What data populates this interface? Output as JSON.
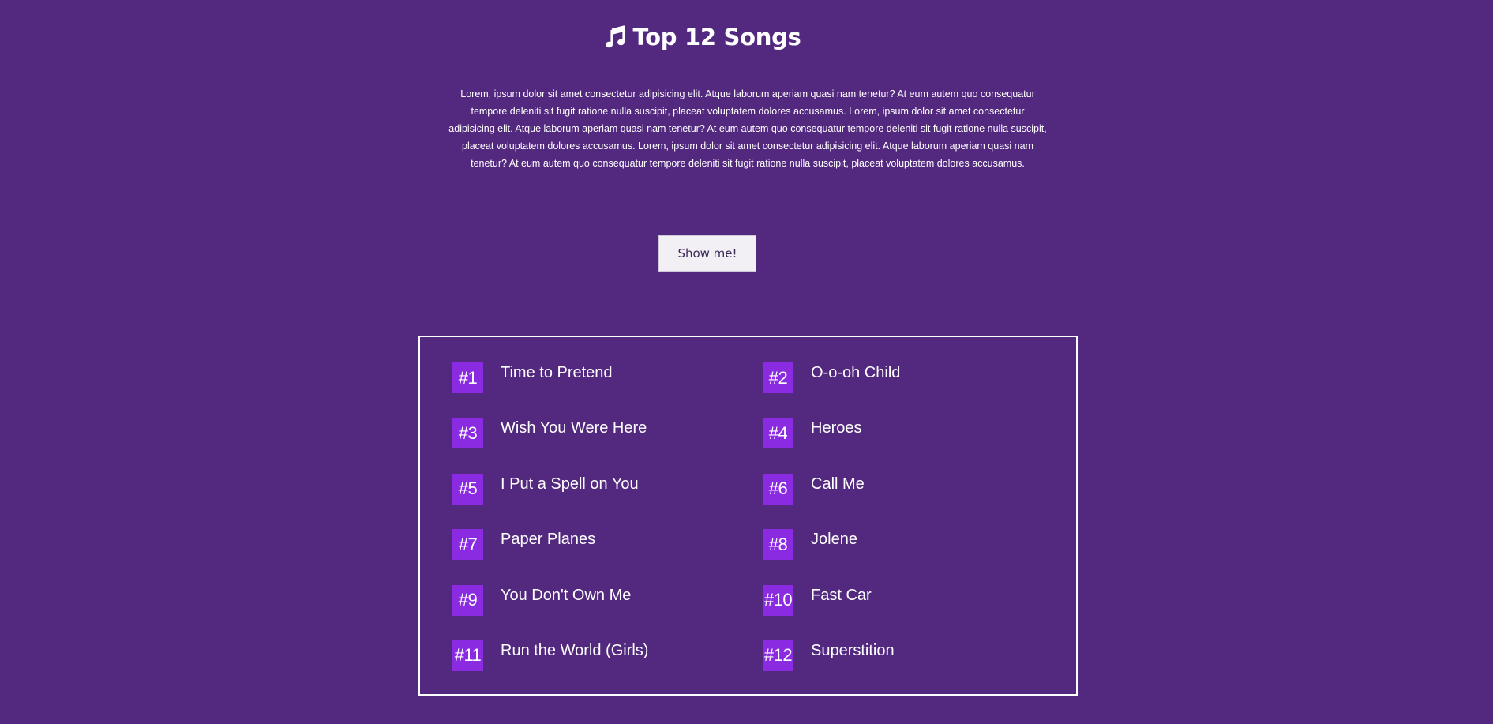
{
  "header": {
    "icon": "music-note-icon",
    "title": "Top 12 Songs"
  },
  "intro": {
    "text": "Lorem, ipsum dolor sit amet consectetur adipisicing elit. Atque laborum aperiam quasi nam tenetur? At eum autem quo consequatur tempore deleniti sit fugit ratione nulla suscipit, placeat voluptatem dolores accusamus. Lorem, ipsum dolor sit amet consectetur adipisicing elit. Atque laborum aperiam quasi nam tenetur? At eum autem quo consequatur tempore deleniti sit fugit ratione nulla suscipit, placeat voluptatem dolores accusamus. Lorem, ipsum dolor sit amet consectetur adipisicing elit. Atque laborum aperiam quasi nam tenetur? At eum autem quo consequatur tempore deleniti sit fugit ratione nulla suscipit, placeat voluptatem dolores accusamus."
  },
  "show_button": {
    "label": "Show me!"
  },
  "colors": {
    "background": "#53297f",
    "badge": "#8a2be2",
    "border": "#ffffff",
    "button_bg": "#f2eff5"
  },
  "songs": [
    {
      "rank": "#1",
      "title": "Time to Pretend"
    },
    {
      "rank": "#2",
      "title": "O-o-oh Child"
    },
    {
      "rank": "#3",
      "title": "Wish You Were Here"
    },
    {
      "rank": "#4",
      "title": "Heroes"
    },
    {
      "rank": "#5",
      "title": "I Put a Spell on You"
    },
    {
      "rank": "#6",
      "title": "Call Me"
    },
    {
      "rank": "#7",
      "title": "Paper Planes"
    },
    {
      "rank": "#8",
      "title": "Jolene"
    },
    {
      "rank": "#9",
      "title": "You Don't Own Me"
    },
    {
      "rank": "#10",
      "title": "Fast Car"
    },
    {
      "rank": "#11",
      "title": "Run the World (Girls)"
    },
    {
      "rank": "#12",
      "title": "Superstition"
    }
  ]
}
